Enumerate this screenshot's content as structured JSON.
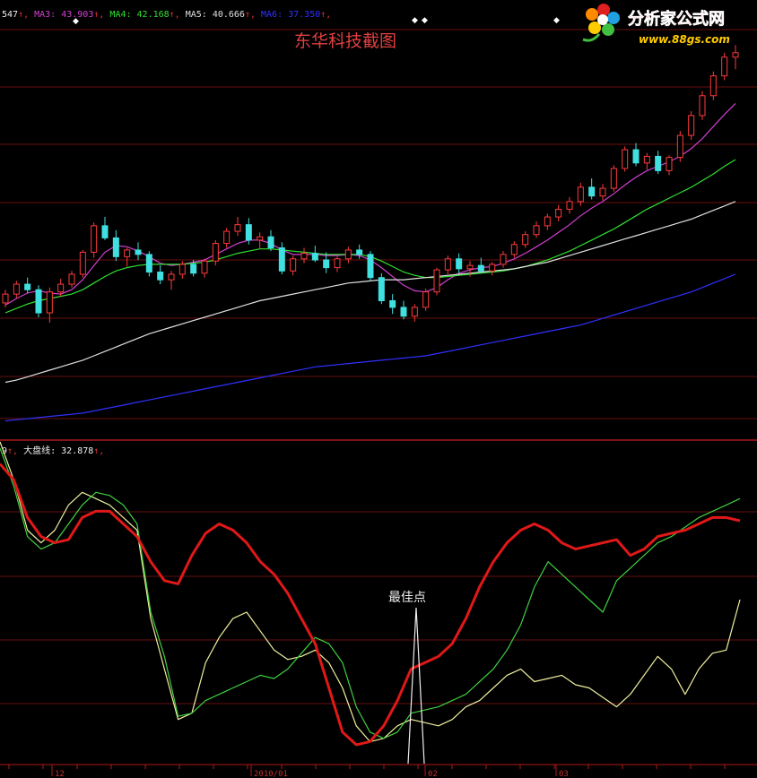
{
  "chart_data": [
    {
      "type": "candlestick",
      "title": "东华科技截图",
      "legend": [
        {
          "name": "547",
          "color": "#f0f0f0"
        },
        {
          "name": "MA3: 43.903",
          "color": "#d040d0"
        },
        {
          "name": "MA4: 42.168",
          "color": "#30e030"
        },
        {
          "name": "MA5: 40.666",
          "color": "#e0e0e0"
        },
        {
          "name": "MA6: 37.350",
          "color": "#3030ff"
        }
      ],
      "ylim": [
        18,
        55
      ],
      "candles": [
        [
          30.2,
          31.4,
          29.8,
          31.0
        ],
        [
          31.0,
          32.2,
          30.6,
          31.9
        ],
        [
          31.9,
          32.5,
          31.1,
          31.4
        ],
        [
          31.4,
          31.8,
          28.9,
          29.3
        ],
        [
          29.3,
          31.6,
          28.4,
          31.2
        ],
        [
          31.2,
          32.4,
          30.8,
          31.9
        ],
        [
          31.9,
          33.1,
          31.6,
          32.8
        ],
        [
          32.8,
          35.0,
          32.5,
          34.8
        ],
        [
          34.8,
          37.5,
          34.3,
          37.2
        ],
        [
          37.2,
          38.0,
          35.9,
          36.1
        ],
        [
          36.1,
          36.8,
          34.0,
          34.4
        ],
        [
          34.4,
          35.2,
          33.5,
          35.0
        ],
        [
          35.0,
          35.7,
          34.1,
          34.6
        ],
        [
          34.6,
          34.9,
          32.6,
          33.0
        ],
        [
          33.0,
          33.6,
          31.9,
          32.3
        ],
        [
          32.3,
          33.1,
          31.4,
          32.8
        ],
        [
          32.8,
          34.0,
          32.4,
          33.7
        ],
        [
          33.7,
          34.1,
          32.6,
          32.9
        ],
        [
          32.9,
          34.2,
          32.5,
          34.0
        ],
        [
          34.0,
          35.9,
          33.6,
          35.6
        ],
        [
          35.6,
          37.0,
          35.2,
          36.7
        ],
        [
          36.7,
          38.0,
          36.3,
          37.3
        ],
        [
          37.3,
          37.9,
          35.5,
          35.9
        ],
        [
          35.9,
          36.6,
          35.1,
          36.2
        ],
        [
          36.2,
          36.8,
          34.9,
          35.2
        ],
        [
          35.2,
          35.7,
          32.8,
          33.1
        ],
        [
          33.1,
          34.5,
          32.7,
          34.2
        ],
        [
          34.2,
          35.2,
          33.8,
          34.7
        ],
        [
          34.7,
          35.4,
          33.9,
          34.1
        ],
        [
          34.1,
          34.8,
          32.9,
          33.4
        ],
        [
          33.4,
          34.4,
          33.0,
          34.2
        ],
        [
          34.2,
          35.3,
          33.8,
          35.0
        ],
        [
          35.0,
          35.5,
          34.2,
          34.6
        ],
        [
          34.6,
          34.9,
          32.2,
          32.5
        ],
        [
          32.5,
          32.9,
          30.1,
          30.4
        ],
        [
          30.4,
          31.0,
          29.2,
          29.8
        ],
        [
          29.8,
          30.4,
          28.7,
          29.0
        ],
        [
          29.0,
          30.1,
          28.5,
          29.8
        ],
        [
          29.8,
          31.5,
          29.5,
          31.2
        ],
        [
          31.2,
          33.4,
          30.9,
          33.2
        ],
        [
          33.2,
          34.5,
          32.8,
          34.2
        ],
        [
          34.2,
          34.7,
          32.9,
          33.3
        ],
        [
          33.3,
          34.0,
          32.6,
          33.6
        ],
        [
          33.6,
          34.3,
          32.9,
          33.1
        ],
        [
          33.1,
          33.9,
          32.7,
          33.7
        ],
        [
          33.7,
          34.9,
          33.4,
          34.6
        ],
        [
          34.6,
          35.8,
          34.3,
          35.5
        ],
        [
          35.5,
          36.7,
          35.2,
          36.4
        ],
        [
          36.4,
          37.6,
          36.1,
          37.2
        ],
        [
          37.2,
          38.3,
          36.8,
          38.0
        ],
        [
          38.0,
          39.1,
          37.6,
          38.7
        ],
        [
          38.7,
          39.8,
          38.3,
          39.4
        ],
        [
          39.4,
          41.1,
          39.0,
          40.7
        ],
        [
          40.7,
          41.5,
          39.6,
          39.9
        ],
        [
          39.9,
          41.0,
          39.5,
          40.6
        ],
        [
          40.6,
          42.7,
          40.3,
          42.4
        ],
        [
          42.4,
          44.4,
          42.1,
          44.1
        ],
        [
          44.1,
          44.7,
          42.6,
          42.9
        ],
        [
          42.9,
          43.8,
          42.3,
          43.5
        ],
        [
          43.5,
          44.0,
          41.9,
          42.2
        ],
        [
          42.2,
          43.6,
          41.8,
          43.4
        ],
        [
          43.4,
          45.8,
          43.0,
          45.4
        ],
        [
          45.4,
          47.6,
          45.0,
          47.2
        ],
        [
          47.2,
          49.4,
          46.8,
          49.0
        ],
        [
          49.0,
          51.2,
          48.6,
          50.8
        ],
        [
          50.8,
          52.9,
          50.4,
          52.5
        ],
        [
          52.5,
          53.6,
          51.4,
          52.9
        ]
      ],
      "moving_averages": [
        {
          "name": "MA3",
          "color": "#d040d0",
          "values": [
            30.0,
            30.6,
            31.1,
            31.3,
            31.1,
            31.0,
            31.4,
            32.3,
            33.6,
            34.8,
            35.4,
            35.3,
            34.9,
            34.4,
            33.8,
            33.6,
            33.7,
            33.9,
            34.1,
            34.6,
            35.1,
            35.6,
            35.9,
            35.9,
            35.6,
            35.0,
            34.6,
            34.6,
            34.6,
            34.5,
            34.5,
            34.6,
            34.5,
            34.1,
            33.4,
            32.6,
            31.8,
            31.3,
            31.2,
            31.6,
            32.3,
            32.9,
            33.2,
            33.4,
            33.5,
            33.8,
            34.2,
            34.7,
            35.3,
            35.9,
            36.6,
            37.3,
            38.1,
            38.8,
            39.4,
            40.1,
            40.9,
            41.6,
            42.2,
            42.6,
            43.0,
            43.5,
            44.2,
            45.1,
            46.2,
            47.3,
            48.3
          ]
        },
        {
          "name": "MA4",
          "color": "#30e030",
          "values": [
            29.3,
            29.7,
            30.1,
            30.4,
            30.6,
            30.8,
            31.0,
            31.4,
            32.0,
            32.6,
            33.1,
            33.4,
            33.6,
            33.7,
            33.7,
            33.7,
            33.7,
            33.8,
            33.9,
            34.1,
            34.4,
            34.7,
            34.9,
            35.1,
            35.1,
            35.0,
            34.9,
            34.8,
            34.7,
            34.6,
            34.6,
            34.6,
            34.6,
            34.4,
            34.0,
            33.5,
            33.0,
            32.7,
            32.5,
            32.5,
            32.6,
            32.7,
            32.8,
            32.9,
            33.0,
            33.1,
            33.3,
            33.5,
            33.8,
            34.1,
            34.5,
            34.9,
            35.4,
            35.9,
            36.4,
            36.9,
            37.5,
            38.1,
            38.7,
            39.2,
            39.7,
            40.2,
            40.7,
            41.3,
            41.9,
            42.6,
            43.2
          ]
        },
        {
          "name": "MA5",
          "color": "#e0e0e0",
          "values": [
            23.0,
            23.2,
            23.5,
            23.8,
            24.1,
            24.4,
            24.7,
            25.0,
            25.4,
            25.8,
            26.2,
            26.6,
            27.0,
            27.4,
            27.7,
            28.0,
            28.3,
            28.6,
            28.9,
            29.2,
            29.5,
            29.8,
            30.1,
            30.4,
            30.6,
            30.8,
            31.0,
            31.2,
            31.4,
            31.6,
            31.8,
            32.0,
            32.1,
            32.2,
            32.3,
            32.3,
            32.3,
            32.4,
            32.5,
            32.6,
            32.7,
            32.8,
            32.9,
            33.0,
            33.1,
            33.2,
            33.3,
            33.5,
            33.7,
            33.9,
            34.2,
            34.5,
            34.8,
            35.1,
            35.4,
            35.7,
            36.0,
            36.3,
            36.6,
            36.9,
            37.2,
            37.5,
            37.8,
            38.2,
            38.6,
            39.0,
            39.4
          ]
        },
        {
          "name": "MA6",
          "color": "#3030ff",
          "values": [
            19.5,
            19.6,
            19.7,
            19.8,
            19.9,
            20.0,
            20.1,
            20.2,
            20.4,
            20.6,
            20.8,
            21.0,
            21.2,
            21.4,
            21.6,
            21.8,
            22.0,
            22.2,
            22.4,
            22.6,
            22.8,
            23.0,
            23.2,
            23.4,
            23.6,
            23.8,
            24.0,
            24.2,
            24.4,
            24.5,
            24.6,
            24.7,
            24.8,
            24.9,
            25.0,
            25.1,
            25.2,
            25.3,
            25.4,
            25.6,
            25.8,
            26.0,
            26.2,
            26.4,
            26.6,
            26.8,
            27.0,
            27.2,
            27.4,
            27.6,
            27.8,
            28.0,
            28.2,
            28.5,
            28.8,
            29.1,
            29.4,
            29.7,
            30.0,
            30.3,
            30.6,
            30.9,
            31.2,
            31.6,
            32.0,
            32.4,
            32.8
          ]
        }
      ]
    },
    {
      "type": "line",
      "legend": [
        {
          "name": "9",
          "color": "#f0f0f0"
        },
        {
          "name": "大盘线: 32.878",
          "color": "#f0f0f0"
        }
      ],
      "ylim": [
        0,
        100
      ],
      "x_ticks": [
        "12",
        "2010/01",
        "02",
        "03"
      ],
      "annotation": "最佳点",
      "series": [
        {
          "name": "red",
          "color": "#e01818",
          "values": [
            95,
            90,
            78,
            72,
            70,
            71,
            78,
            80,
            80,
            76,
            72,
            64,
            58,
            57,
            66,
            73,
            76,
            74,
            70,
            64,
            60,
            54,
            46,
            38,
            24,
            10,
            6,
            7,
            12,
            20,
            30,
            32,
            34,
            38,
            46,
            56,
            64,
            70,
            74,
            76,
            74,
            70,
            68,
            69,
            70,
            71,
            66,
            68,
            72,
            73,
            74,
            76,
            78,
            78,
            77
          ]
        },
        {
          "name": "green",
          "color": "#40d040",
          "values": [
            100,
            88,
            72,
            68,
            70,
            76,
            82,
            86,
            85,
            82,
            76,
            48,
            34,
            15,
            16,
            20,
            22,
            24,
            26,
            28,
            27,
            30,
            35,
            40,
            38,
            32,
            18,
            10,
            8,
            10,
            16,
            17,
            18,
            20,
            22,
            26,
            30,
            36,
            44,
            56,
            64,
            60,
            56,
            52,
            48,
            58,
            62,
            66,
            70,
            72,
            75,
            78,
            80,
            82,
            84
          ]
        },
        {
          "name": "yellow",
          "color": "#f0f0a0",
          "values": [
            102,
            90,
            74,
            70,
            74,
            82,
            86,
            84,
            82,
            78,
            74,
            46,
            30,
            14,
            16,
            32,
            40,
            46,
            48,
            42,
            36,
            33,
            34,
            36,
            32,
            24,
            12,
            7,
            8,
            12,
            14,
            13,
            12,
            14,
            18,
            20,
            24,
            28,
            30,
            26,
            27,
            28,
            25,
            24,
            21,
            18,
            22,
            28,
            34,
            30,
            22,
            30,
            35,
            36,
            52
          ]
        }
      ]
    }
  ],
  "watermark": {
    "main": "分析家公式网",
    "sub": "www.88gs.com"
  }
}
